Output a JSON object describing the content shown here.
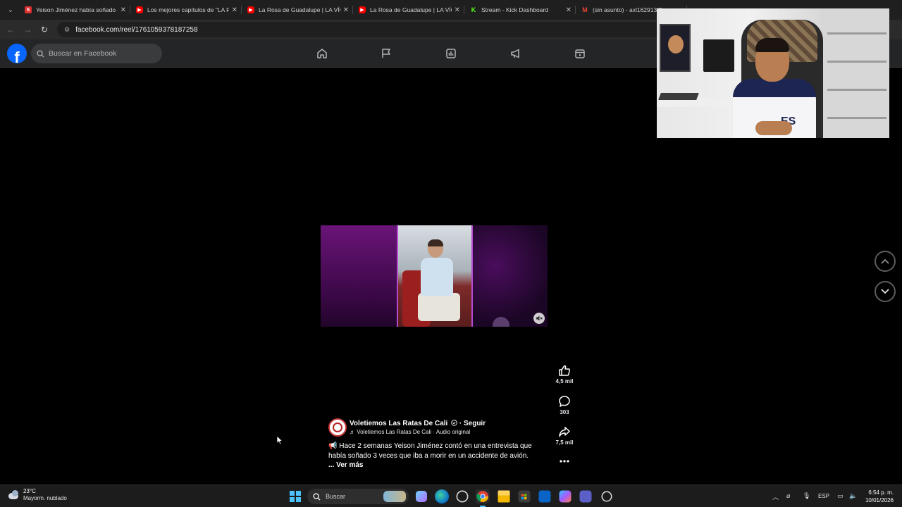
{
  "browser": {
    "tabs": [
      {
        "title": "Yeison Jiménez había soñado q",
        "favicon": "red-s-icon"
      },
      {
        "title": "Los mejores capítulos de \"LA R",
        "favicon": "youtube-icon"
      },
      {
        "title": "La Rosa de Guadalupe | LA VÍC",
        "favicon": "youtube-icon"
      },
      {
        "title": "La Rosa de Guadalupe | LA VÍC",
        "favicon": "youtube-icon"
      },
      {
        "title": "Stream - Kick Dashboard",
        "favicon": "kick-icon"
      },
      {
        "title": "(sin asunto) - axl162913@",
        "favicon": "gmail-icon"
      }
    ],
    "url": "facebook.com/reel/1761059378187258"
  },
  "facebook": {
    "search_placeholder": "Buscar en Facebook",
    "nav_icons": [
      "home-icon",
      "flag-icon",
      "chart-icon",
      "megaphone-icon",
      "marketplace-icon"
    ]
  },
  "reel": {
    "actions": {
      "likes": "4,5 mil",
      "comments": "303",
      "shares": "7,5 mil"
    },
    "author": {
      "name": "Voletiemos Las Ratas De Cali",
      "follow": "· Seguir",
      "audio": "Voletiemos Las Ratas De Cali · Audio original"
    },
    "caption": "Hace 2 semanas Yeison Jiménez contó en una entrevista que había soñado 3 veces que iba a morir en un accidente de avión.",
    "caption_more": "... Ver más"
  },
  "taskbar": {
    "weather_temp": "23°C",
    "weather_cond": "Mayorm. nublado",
    "search_label": "Buscar",
    "lang": "ESP",
    "time": "6:54 p. m.",
    "date": "10/01/2026"
  },
  "colors": {
    "fb_blue": "#0866ff",
    "fb_header": "#242526",
    "accent_purple": "#b44bd0"
  }
}
